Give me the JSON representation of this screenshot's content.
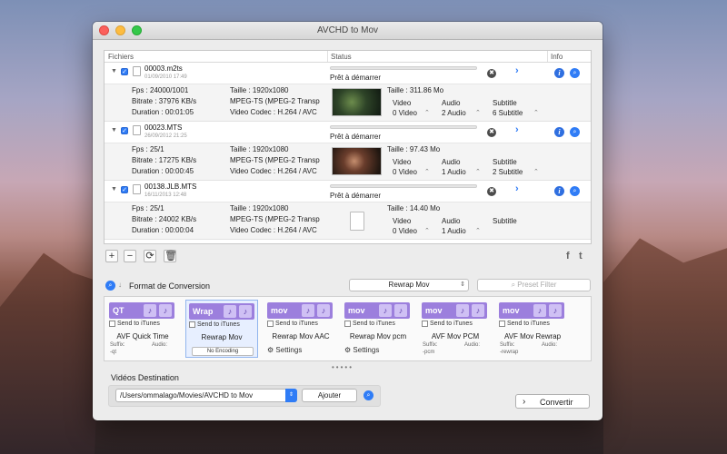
{
  "window": {
    "title": "AVCHD to Mov"
  },
  "table": {
    "headers": {
      "files": "Fichiers",
      "status": "Status",
      "info": "Info"
    }
  },
  "files": [
    {
      "name": "00003.m2ts",
      "date": "01/09/2010 17:49",
      "status": "Prêt à démarrer",
      "fps": "Fps : 24000/1001",
      "bitrate": "Bitrate : 37976 KB/s",
      "duration": "Duration : 00:01:05",
      "size": "Taille : 1920x1080",
      "container": "MPEG-TS (MPEG-2 Transp",
      "codec": "Video Codec : H.264 / AVC",
      "filesize": "Taille : 311.86 Mo",
      "video_label": "Video",
      "video_value": "0 Video",
      "audio_label": "Audio",
      "audio_value": "2 Audio",
      "subtitle_label": "Subtitle",
      "subtitle_value": "6 Subtitle"
    },
    {
      "name": "00023.MTS",
      "date": "26/09/2012 21:25",
      "status": "Prêt à démarrer",
      "fps": "Fps : 25/1",
      "bitrate": "Bitrate : 17275 KB/s",
      "duration": "Duration : 00:00:45",
      "size": "Taille : 1920x1080",
      "container": "MPEG-TS (MPEG-2 Transp",
      "codec": "Video Codec : H.264 / AVC",
      "filesize": "Taille : 97.43 Mo",
      "video_label": "Video",
      "video_value": "0 Video",
      "audio_label": "Audio",
      "audio_value": "1 Audio",
      "subtitle_label": "Subtitle",
      "subtitle_value": "2 Subtitle"
    },
    {
      "name": "00138.JLB.MTS",
      "date": "16/11/2013 12:48",
      "status": "Prêt à démarrer",
      "fps": "Fps : 25/1",
      "bitrate": "Bitrate : 24002 KB/s",
      "duration": "Duration : 00:00:04",
      "size": "Taille : 1920x1080",
      "container": "MPEG-TS (MPEG-2 Transp",
      "codec": "Video Codec : H.264 / AVC",
      "filesize": "Taille : 14.40 Mo",
      "video_label": "Video",
      "video_value": "0 Video",
      "audio_label": "Audio",
      "audio_value": "1 Audio",
      "subtitle_label": "Subtitle",
      "subtitle_value": ""
    }
  ],
  "format": {
    "label": "Format de Conversion",
    "selected": "Rewrap Mov",
    "search_placeholder": "Preset Filter"
  },
  "presets": [
    {
      "badge": "QT",
      "itunes": "Send to iTunes",
      "title": "AVF Quick Time",
      "suffix_label": "Suffix:",
      "suffix": "-qt",
      "audio_label": "Audio:"
    },
    {
      "badge": "Wrap",
      "itunes": "Send to iTunes",
      "title": "Rewrap Mov",
      "extra": "No Encoding"
    },
    {
      "badge": "mov",
      "itunes": "Send to iTunes",
      "title": "Rewrap Mov AAC",
      "settings": "Settings"
    },
    {
      "badge": "mov",
      "itunes": "Send to iTunes",
      "title": "Rewrap Mov pcm",
      "settings": "Settings"
    },
    {
      "badge": "mov",
      "itunes": "Send to iTunes",
      "title": "AVF Mov PCM",
      "suffix_label": "Suffix:",
      "suffix": "-pcm",
      "audio_label": "Audio:"
    },
    {
      "badge": "mov",
      "itunes": "Send to iTunes",
      "title": "AVF Mov Rewrap",
      "suffix_label": "Suffix:",
      "suffix": "-rewrap",
      "audio_label": "Audio:"
    }
  ],
  "pager": "•••••",
  "destination": {
    "label": "Vidéos Destination",
    "path": "/Users/ommalago/Movies/AVCHD to Mov",
    "add_label": "Ajouter"
  },
  "convert_label": "Convertir",
  "icons": {
    "info": "i",
    "close": "✖",
    "chevron": "›",
    "search": "⌕"
  }
}
